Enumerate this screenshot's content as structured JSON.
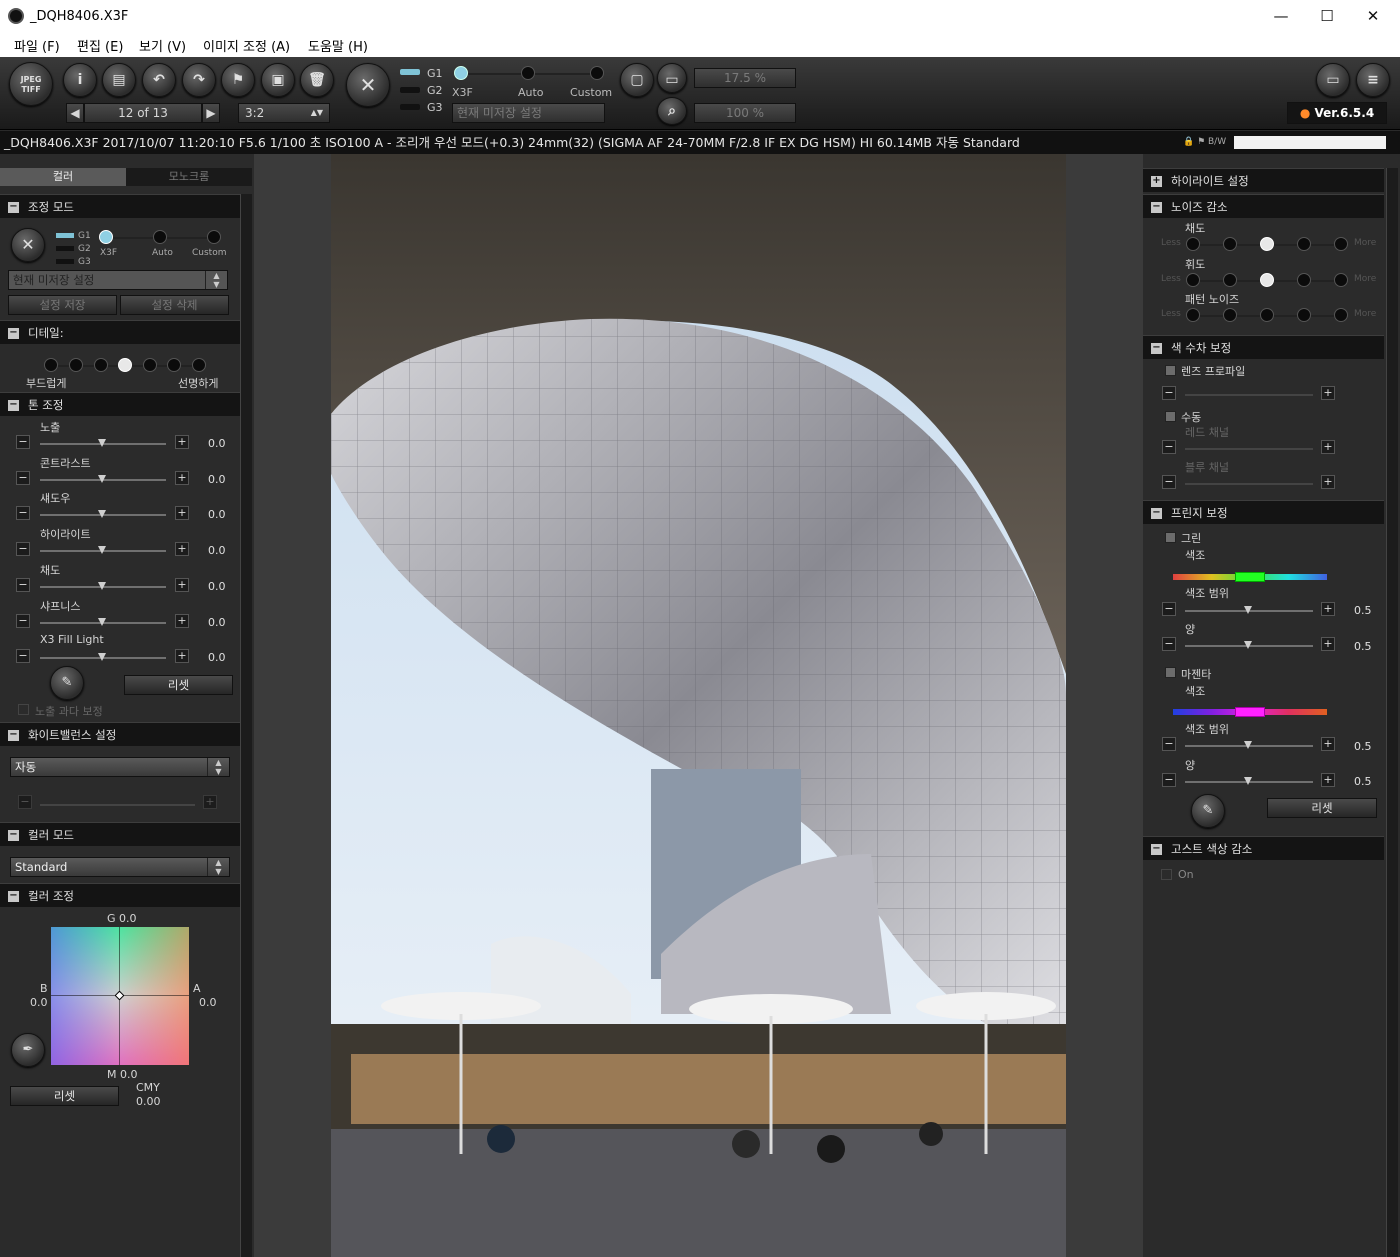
{
  "window": {
    "title": "_DQH8406.X3F",
    "minimize": "—",
    "maximize": "☐",
    "close": "✕"
  },
  "menu": [
    "파일 (F)",
    "편집 (E)",
    "보기 (V)",
    "이미지 조정 (A)",
    "도움말 (H)"
  ],
  "toolbar": {
    "jpeg_tiff": "JPEG TIFF",
    "nav_counter": "12 of 13",
    "nav_prev": "◀",
    "nav_next": "▶",
    "aspect": "3:2",
    "modes": [
      "X3F",
      "Auto",
      "Custom"
    ],
    "g_labels": [
      "G1",
      "G2",
      "G3"
    ],
    "preset_select": "현재 미저장 설정",
    "zoom1": "17.5 %",
    "zoom2": "100 %",
    "version": "Ver.6.5.4"
  },
  "infobar": {
    "text": "_DQH8406.X3F 2017/10/07 11:20:10 F5.6 1/100 초 ISO100 A - 조리개 우선 모드(+0.3) 24mm(32) (SIGMA AF 24-70MM F/2.8 IF EX DG HSM) HI 60.14MB 자동 Standard",
    "bw": "B/W"
  },
  "left": {
    "tabs": [
      "컬러",
      "모노크롬"
    ],
    "adjust_mode": {
      "title": "조정 모드",
      "g_labels": [
        "G1",
        "G2",
        "G3"
      ],
      "modes": [
        "X3F",
        "Auto",
        "Custom"
      ],
      "preset": "현재 미저장 설정",
      "save": "설정 저장",
      "delete": "설정 삭제"
    },
    "detail": {
      "title": "디테일:",
      "left_label": "부드럽게",
      "right_label": "선명하게",
      "level": 4
    },
    "tone": {
      "title": "톤 조정",
      "sliders": [
        {
          "label": "노출",
          "value": "0.0"
        },
        {
          "label": "콘트라스트",
          "value": "0.0"
        },
        {
          "label": "섀도우",
          "value": "0.0"
        },
        {
          "label": "하이라이트",
          "value": "0.0"
        },
        {
          "label": "채도",
          "value": "0.0"
        },
        {
          "label": "샤프니스",
          "value": "0.0"
        },
        {
          "label": "X3 Fill Light",
          "value": "0.0"
        }
      ],
      "reset": "리셋",
      "overexposure": "노출 과다 보정"
    },
    "wb": {
      "title": "화이트밸런스 설정",
      "value": "자동"
    },
    "color_mode": {
      "title": "컬러 모드",
      "value": "Standard"
    },
    "color_adj": {
      "title": "컬러 조정",
      "g": "G 0.0",
      "b_label": "B",
      "b_val": "0.0",
      "a_label": "A",
      "a_val": "0.0",
      "m": "M 0.0",
      "cmy": "CMY",
      "cmy_val": "0.00",
      "reset": "리셋"
    }
  },
  "right": {
    "highlight": "하이라이트 설정",
    "noise": {
      "title": "노이즈 감소",
      "rows": [
        {
          "label": "채도",
          "level": 3
        },
        {
          "label": "휘도",
          "level": 3
        },
        {
          "label": "패턴 노이즈",
          "level": 0
        }
      ],
      "less": "Less",
      "more": "More"
    },
    "aberration": {
      "title": "색 수차 보정",
      "lens": "렌즈 프로파일",
      "manual": "수동",
      "red": "레드 채널",
      "blue": "블루 채널"
    },
    "fringe": {
      "title": "프린지 보정",
      "green": {
        "label": "그린",
        "hue": "색조",
        "range": "색조 범위",
        "range_val": "0.5",
        "amount": "양",
        "amount_val": "0.5"
      },
      "magenta": {
        "label": "마젠타",
        "hue": "색조",
        "range": "색조 범위",
        "range_val": "0.5",
        "amount": "양",
        "amount_val": "0.5"
      },
      "reset": "리셋"
    },
    "ghost": {
      "title": "고스트 색상 감소",
      "on": "On"
    }
  }
}
